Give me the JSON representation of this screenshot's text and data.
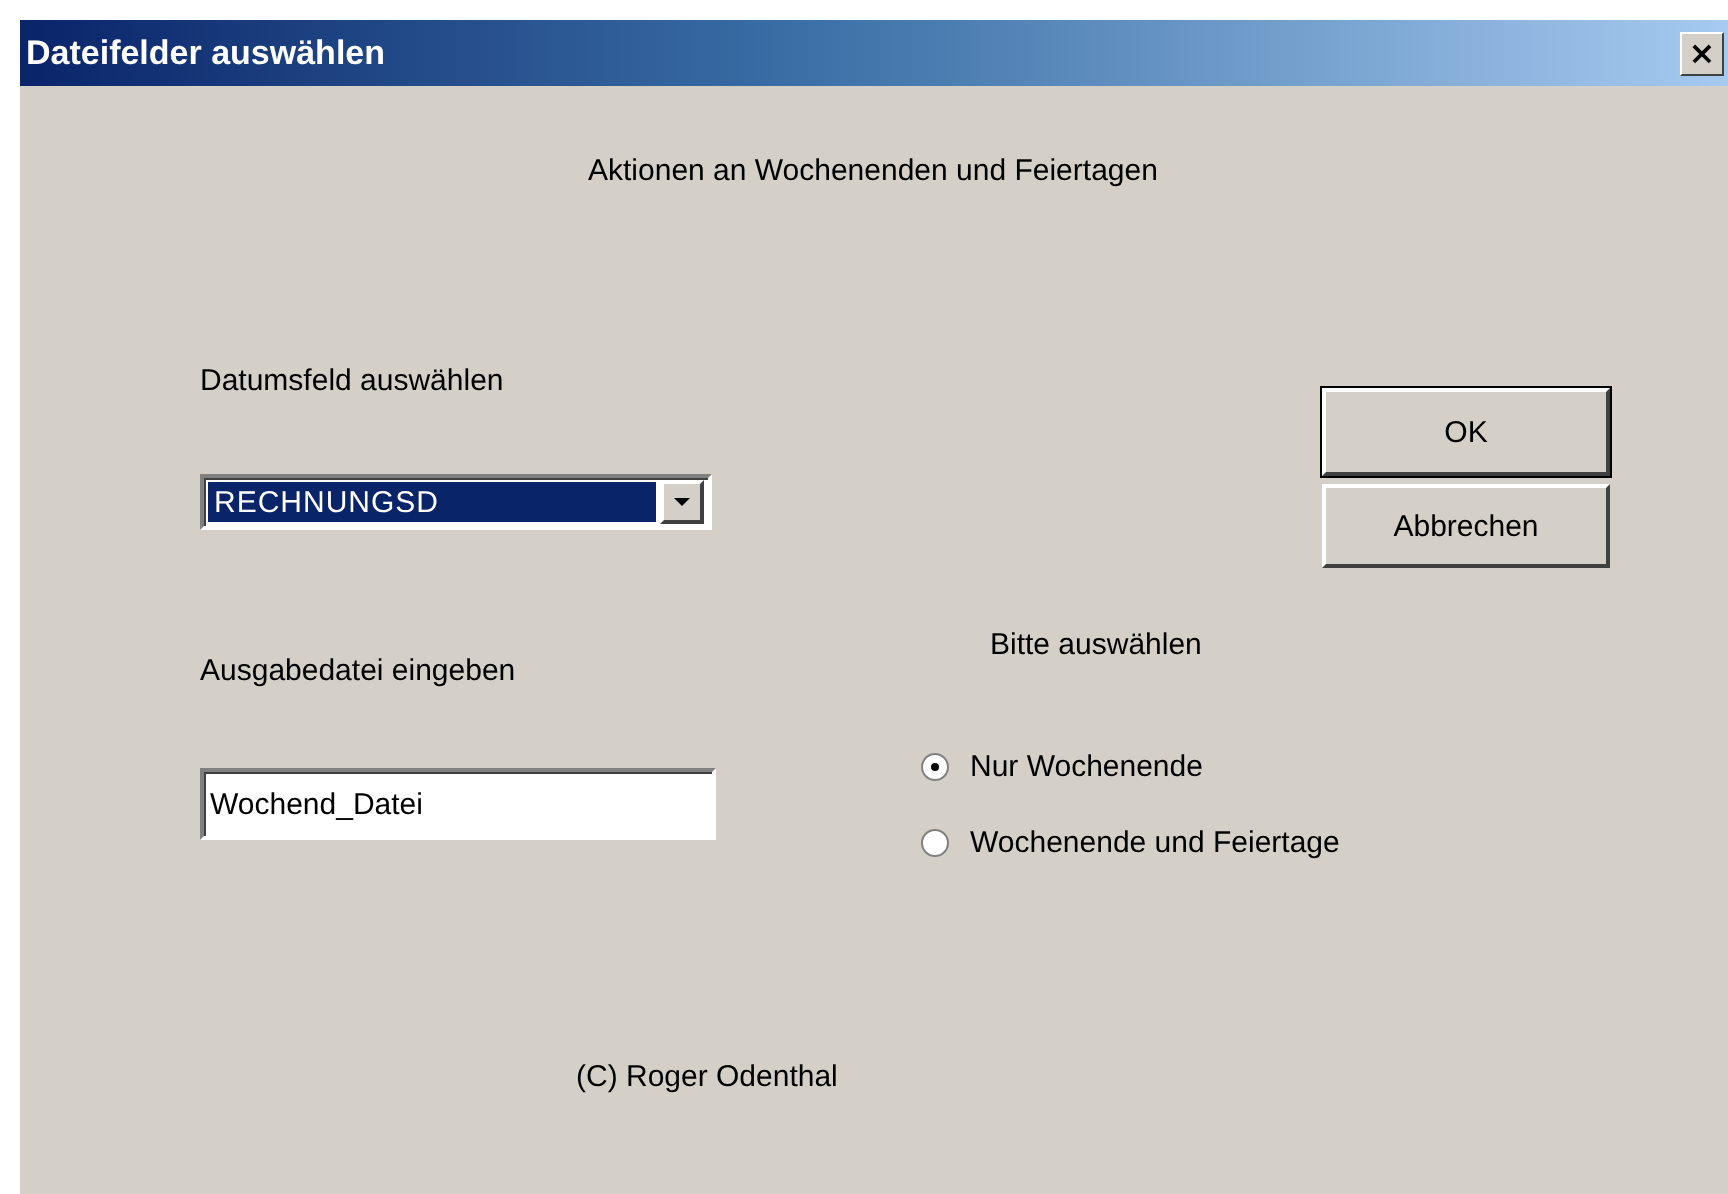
{
  "window": {
    "title": "Dateifelder auswählen",
    "close": "×"
  },
  "heading": "Aktionen an Wochenenden und Feiertagen",
  "date_field": {
    "label": "Datumsfeld auswählen",
    "value": "RECHNUNGSD"
  },
  "output_file": {
    "label": "Ausgabedatei eingeben",
    "value": "Wochend_Datei"
  },
  "buttons": [
    {
      "label": "OK",
      "default": true
    },
    {
      "label": "Abbrechen",
      "default": false
    }
  ],
  "options": {
    "label": "Bitte auswählen",
    "items": [
      {
        "label": "Nur Wochenende",
        "selected": true
      },
      {
        "label": "Wochenende und Feiertage",
        "selected": false
      }
    ]
  },
  "footer": "(C) Roger Odenthal"
}
